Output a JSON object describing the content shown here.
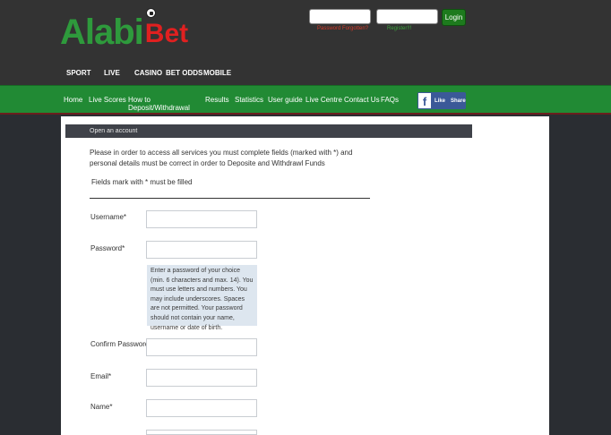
{
  "header": {
    "logo": {
      "text_main": "Alabi",
      "text_accent": "Bet"
    },
    "login": {
      "button_label": "Login",
      "forgot_label": "Password Forgotten?",
      "register_label": "Register!!!"
    },
    "top_nav": [
      "SPORT",
      "LIVE",
      "CASINO",
      "BET ODDS",
      "MOBILE"
    ]
  },
  "main_nav": {
    "items": [
      "Home",
      "Live Scores",
      "How to Deposit/Withdrawal",
      "Results",
      "Statistics",
      "User guide",
      "Live Centre",
      "Contact Us",
      "FAQs"
    ],
    "facebook": {
      "icon": "f",
      "like": "Like",
      "share": "Share"
    }
  },
  "form": {
    "section_title": "Open an account",
    "intro": "Please in order to access all services you must complete fields (marked with *) and personal details must be correct in order to Deposite and Withdrawl Funds",
    "fields_note": "Fields mark with * must be filled",
    "fields": {
      "username": "Username*",
      "password": "Password*",
      "confirm_password": "Confirm Password*",
      "email": "Email*",
      "name": "Name*"
    },
    "password_help": "Enter a password of your choice (min. 6 characters and max. 14). You must use letters and numbers. You may include underscores. Spaces are not permitted. Your password should not contain your name, username or date of birth."
  },
  "colors": {
    "header_bg": "#333333",
    "nav_green": "#218a34",
    "brand_green": "#2e9a3c",
    "brand_red": "#e02020",
    "facebook_blue": "#3b5998"
  }
}
